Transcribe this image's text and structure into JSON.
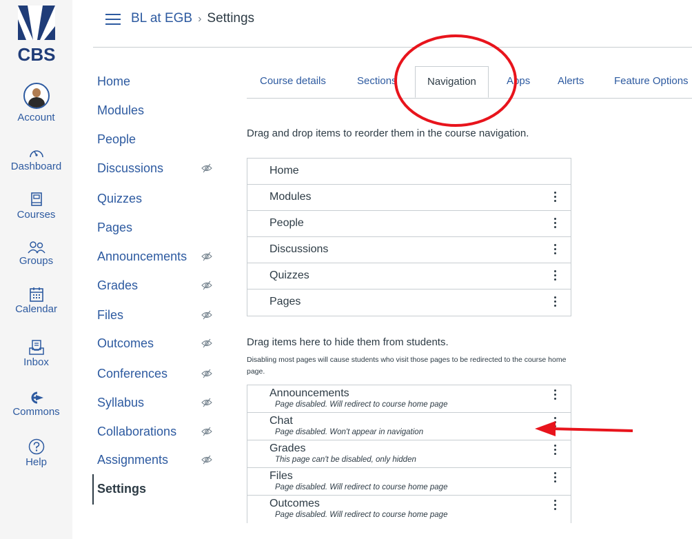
{
  "logo": {
    "text": "CBS"
  },
  "global_nav": [
    {
      "id": "account",
      "label": "Account",
      "icon": "avatar"
    },
    {
      "id": "dashboard",
      "label": "Dashboard",
      "icon": "dashboard-icon"
    },
    {
      "id": "courses",
      "label": "Courses",
      "icon": "courses-icon"
    },
    {
      "id": "groups",
      "label": "Groups",
      "icon": "groups-icon"
    },
    {
      "id": "calendar",
      "label": "Calendar",
      "icon": "calendar-icon"
    },
    {
      "id": "inbox",
      "label": "Inbox",
      "icon": "inbox-icon"
    },
    {
      "id": "commons",
      "label": "Commons",
      "icon": "commons-icon"
    },
    {
      "id": "help",
      "label": "Help",
      "icon": "help-icon"
    }
  ],
  "breadcrumb": {
    "course": "BL at EGB",
    "separator": "›",
    "current": "Settings"
  },
  "course_nav": [
    {
      "label": "Home",
      "hidden": false
    },
    {
      "label": "Modules",
      "hidden": false
    },
    {
      "label": "People",
      "hidden": false
    },
    {
      "label": "Discussions",
      "hidden": true
    },
    {
      "label": "Quizzes",
      "hidden": false
    },
    {
      "label": "Pages",
      "hidden": false
    },
    {
      "label": "Announcements",
      "hidden": true
    },
    {
      "label": "Grades",
      "hidden": true
    },
    {
      "label": "Files",
      "hidden": true
    },
    {
      "label": "Outcomes",
      "hidden": true
    },
    {
      "label": "Conferences",
      "hidden": true
    },
    {
      "label": "Syllabus",
      "hidden": true
    },
    {
      "label": "Collaborations",
      "hidden": true
    },
    {
      "label": "Assignments",
      "hidden": true
    },
    {
      "label": "Settings",
      "hidden": false,
      "active": true
    }
  ],
  "tabs": [
    {
      "label": "Course details"
    },
    {
      "label": "Sections"
    },
    {
      "label": "Navigation",
      "active": true
    },
    {
      "label": "Apps"
    },
    {
      "label": "Alerts"
    },
    {
      "label": "Feature Options"
    }
  ],
  "instruction": "Drag and drop items to reorder them in the course navigation.",
  "enabled_items": [
    {
      "label": "Home",
      "menu": false
    },
    {
      "label": "Modules",
      "menu": true
    },
    {
      "label": "People",
      "menu": true
    },
    {
      "label": "Discussions",
      "menu": true
    },
    {
      "label": "Quizzes",
      "menu": true
    },
    {
      "label": "Pages",
      "menu": true
    }
  ],
  "hidden_section": {
    "title": "Drag items here to hide them from students.",
    "note": "Disabling most pages will cause students who visit those pages to be redirected to the course home page."
  },
  "disabled_items": [
    {
      "label": "Announcements",
      "sub": "Page disabled. Will redirect to course home page"
    },
    {
      "label": "Chat",
      "sub": "Page disabled. Won't appear in navigation"
    },
    {
      "label": "Grades",
      "sub": "This page can't be disabled, only hidden"
    },
    {
      "label": "Files",
      "sub": "Page disabled. Will redirect to course home page"
    },
    {
      "label": "Outcomes",
      "sub": "Page disabled. Will redirect to course home page"
    }
  ],
  "colors": {
    "link": "#2d5aa0",
    "text": "#2d3b45",
    "annotation": "#e8141c",
    "border": "#c7cdd1"
  }
}
